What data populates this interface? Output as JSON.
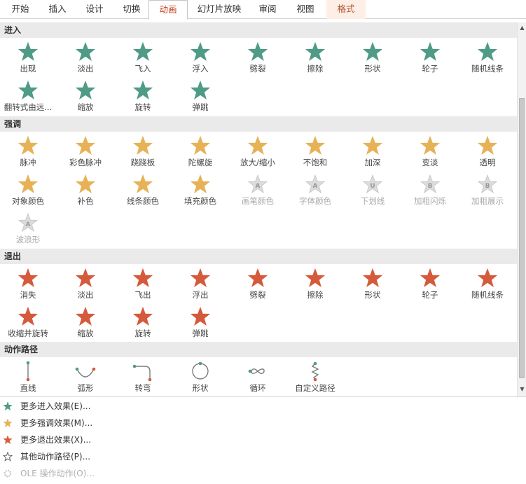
{
  "ribbon": {
    "tabs": [
      {
        "label": "开始",
        "active": false
      },
      {
        "label": "插入",
        "active": false
      },
      {
        "label": "设计",
        "active": false
      },
      {
        "label": "切换",
        "active": false
      },
      {
        "label": "动画",
        "active": true
      },
      {
        "label": "幻灯片放映",
        "active": false
      },
      {
        "label": "审阅",
        "active": false
      },
      {
        "label": "视图",
        "active": false
      },
      {
        "label": "格式",
        "active": false,
        "contextual": true
      }
    ]
  },
  "colors": {
    "entrance": "#4f9b86",
    "emphasis": "#e7b256",
    "exit": "#d55a3b",
    "path": "#7a7a7a",
    "disabled": "#c3c3c3",
    "active_tab_text": "#c43e1c"
  },
  "sections": [
    {
      "title": "进入",
      "kind": "entrance",
      "items": [
        {
          "label": "出现",
          "icon": "appear-star-icon"
        },
        {
          "label": "淡出",
          "icon": "fade-star-icon"
        },
        {
          "label": "飞入",
          "icon": "fly-in-star-icon"
        },
        {
          "label": "浮入",
          "icon": "float-in-star-icon"
        },
        {
          "label": "劈裂",
          "icon": "split-star-icon"
        },
        {
          "label": "擦除",
          "icon": "wipe-star-icon"
        },
        {
          "label": "形状",
          "icon": "shape-star-icon"
        },
        {
          "label": "轮子",
          "icon": "wheel-star-icon"
        },
        {
          "label": "随机线条",
          "icon": "random-bars-star-icon"
        },
        {
          "label": "翻转式由远...",
          "icon": "grow-turn-star-icon"
        },
        {
          "label": "缩放",
          "icon": "zoom-star-icon"
        },
        {
          "label": "旋转",
          "icon": "swivel-star-icon"
        },
        {
          "label": "弹跳",
          "icon": "bounce-star-icon"
        }
      ]
    },
    {
      "title": "强调",
      "kind": "emphasis",
      "items": [
        {
          "label": "脉冲",
          "icon": "pulse-star-icon"
        },
        {
          "label": "彩色脉冲",
          "icon": "color-pulse-star-icon"
        },
        {
          "label": "跷跷板",
          "icon": "teeter-star-icon"
        },
        {
          "label": "陀螺旋",
          "icon": "spin-star-icon"
        },
        {
          "label": "放大/缩小",
          "icon": "grow-shrink-star-icon"
        },
        {
          "label": "不饱和",
          "icon": "desaturate-star-icon"
        },
        {
          "label": "加深",
          "icon": "darken-star-icon"
        },
        {
          "label": "变淡",
          "icon": "lighten-star-icon"
        },
        {
          "label": "透明",
          "icon": "transparency-star-icon"
        },
        {
          "label": "对象颜色",
          "icon": "object-color-star-icon"
        },
        {
          "label": "补色",
          "icon": "complementary-color-star-icon"
        },
        {
          "label": "线条颜色",
          "icon": "line-color-star-icon"
        },
        {
          "label": "填充颜色",
          "icon": "fill-color-star-icon"
        },
        {
          "label": "画笔颜色",
          "icon": "brush-color-star-icon",
          "disabled": true,
          "letter": "A"
        },
        {
          "label": "字体颜色",
          "icon": "font-color-star-icon",
          "disabled": true,
          "letter": "A"
        },
        {
          "label": "下划线",
          "icon": "underline-star-icon",
          "disabled": true,
          "letter": "U"
        },
        {
          "label": "加粗闪烁",
          "icon": "bold-flash-star-icon",
          "disabled": true,
          "letter": "B"
        },
        {
          "label": "加粗展示",
          "icon": "bold-reveal-star-icon",
          "disabled": true,
          "letter": "B"
        },
        {
          "label": "波浪形",
          "icon": "wave-star-icon",
          "disabled": true,
          "letter": "A"
        }
      ]
    },
    {
      "title": "退出",
      "kind": "exit",
      "items": [
        {
          "label": "消失",
          "icon": "disappear-star-icon"
        },
        {
          "label": "淡出",
          "icon": "fade-out-star-icon"
        },
        {
          "label": "飞出",
          "icon": "fly-out-star-icon"
        },
        {
          "label": "浮出",
          "icon": "float-out-star-icon"
        },
        {
          "label": "劈裂",
          "icon": "split-out-star-icon"
        },
        {
          "label": "擦除",
          "icon": "wipe-out-star-icon"
        },
        {
          "label": "形状",
          "icon": "shape-out-star-icon"
        },
        {
          "label": "轮子",
          "icon": "wheel-out-star-icon"
        },
        {
          "label": "随机线条",
          "icon": "random-bars-out-star-icon"
        },
        {
          "label": "收缩并旋转",
          "icon": "shrink-turn-star-icon"
        },
        {
          "label": "缩放",
          "icon": "zoom-out-star-icon"
        },
        {
          "label": "旋转",
          "icon": "swivel-out-star-icon"
        },
        {
          "label": "弹跳",
          "icon": "bounce-out-star-icon"
        }
      ]
    },
    {
      "title": "动作路径",
      "kind": "path",
      "items": [
        {
          "label": "直线",
          "icon": "line-path-icon",
          "path": "line"
        },
        {
          "label": "弧形",
          "icon": "arc-path-icon",
          "path": "arc"
        },
        {
          "label": "转弯",
          "icon": "turn-path-icon",
          "path": "turn"
        },
        {
          "label": "形状",
          "icon": "shape-path-icon",
          "path": "circle"
        },
        {
          "label": "循环",
          "icon": "loop-path-icon",
          "path": "loop"
        },
        {
          "label": "自定义路径",
          "icon": "custom-path-icon",
          "path": "custom"
        }
      ]
    }
  ],
  "more_links": [
    {
      "label": "更多进入效果(E)...",
      "icon": "entrance-star-icon",
      "kind": "entrance"
    },
    {
      "label": "更多强调效果(M)...",
      "icon": "emphasis-star-icon",
      "kind": "emphasis"
    },
    {
      "label": "更多退出效果(X)...",
      "icon": "exit-star-icon",
      "kind": "exit"
    },
    {
      "label": "其他动作路径(P)...",
      "icon": "outline-star-icon",
      "kind": "outline"
    },
    {
      "label": "OLE 操作动作(O)...",
      "icon": "gear-icon",
      "kind": "disabled",
      "disabled": true
    }
  ]
}
